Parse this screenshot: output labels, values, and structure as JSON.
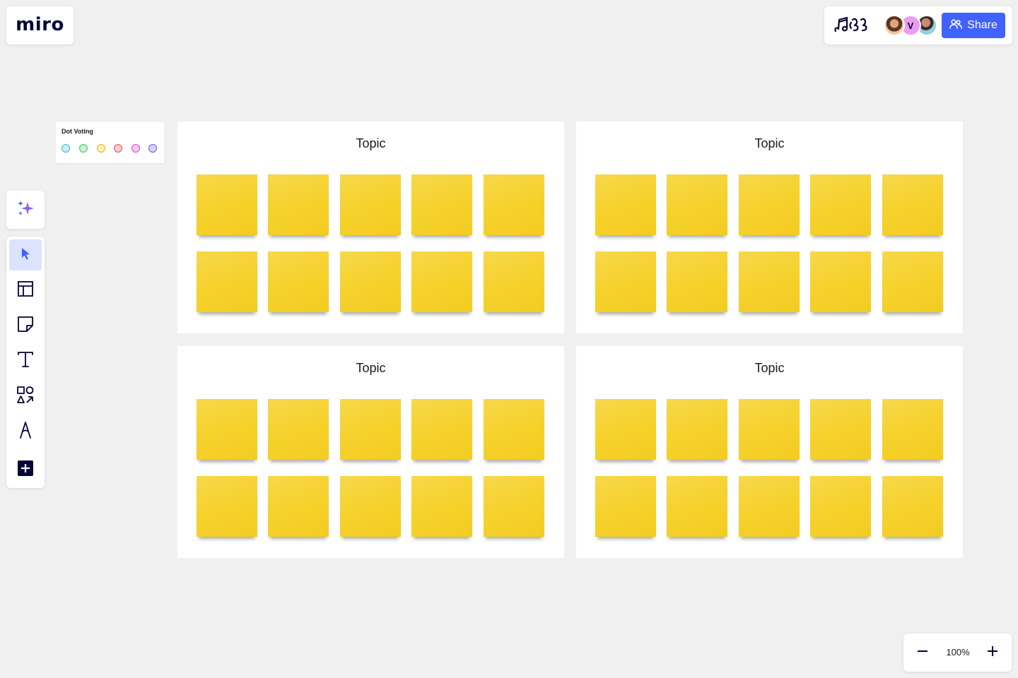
{
  "app": {
    "logo": "miro"
  },
  "header": {
    "reactions_icon": "reactions-icon",
    "collaborators": [
      {
        "type": "photo",
        "icon": "avatar-photo"
      },
      {
        "type": "initial",
        "initial": "V",
        "color": "#eb9cf0"
      },
      {
        "type": "photo",
        "icon": "avatar-photo"
      }
    ],
    "share_label": "Share",
    "accent": "#4262ff"
  },
  "toolbar": {
    "ai_tool": "ai-sparkle-icon",
    "tools": [
      {
        "name": "select",
        "icon": "cursor-icon",
        "active": true
      },
      {
        "name": "templates",
        "icon": "templates-icon",
        "active": false
      },
      {
        "name": "sticky-note",
        "icon": "sticky-note-icon",
        "active": false
      },
      {
        "name": "text",
        "icon": "text-icon",
        "active": false
      },
      {
        "name": "shapes",
        "icon": "shapes-icon",
        "active": false
      },
      {
        "name": "pen",
        "icon": "pen-icon",
        "active": false
      },
      {
        "name": "more-apps",
        "icon": "plus-square-icon",
        "active": false
      }
    ]
  },
  "dot_voting": {
    "title": "Dot Voting",
    "dots": [
      {
        "fill": "#c9ecf6",
        "stroke": "#3fb6d8"
      },
      {
        "fill": "#c9f0d2",
        "stroke": "#45c26a"
      },
      {
        "fill": "#fbf1b0",
        "stroke": "#e0b61c"
      },
      {
        "fill": "#f9cfd2",
        "stroke": "#e0505c"
      },
      {
        "fill": "#f6c8f4",
        "stroke": "#d24bd0"
      },
      {
        "fill": "#d6d3f8",
        "stroke": "#6a5ce0"
      }
    ]
  },
  "frames": [
    {
      "title": "Topic",
      "sticky_count": 10
    },
    {
      "title": "Topic",
      "sticky_count": 10
    },
    {
      "title": "Topic",
      "sticky_count": 10
    },
    {
      "title": "Topic",
      "sticky_count": 10
    }
  ],
  "sticky_color": "#f5d12a",
  "zoom": {
    "level": "100%",
    "zoom_out_icon": "minus-icon",
    "zoom_in_icon": "plus-icon"
  }
}
